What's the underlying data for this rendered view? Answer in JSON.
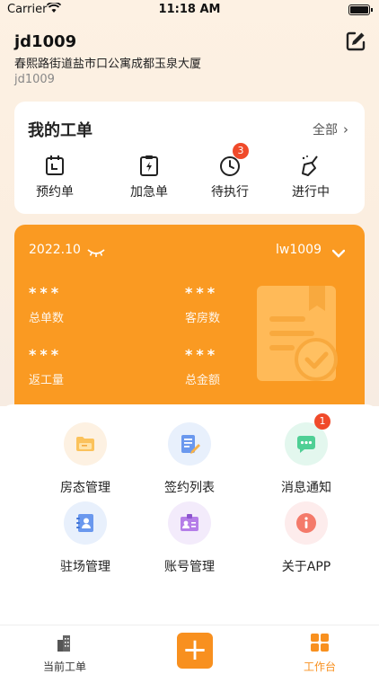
{
  "status_bar": {
    "carrier": "Carrier",
    "time": "11:18 AM"
  },
  "user": {
    "name": "jd1009",
    "address": "春熙路街道盐市口公寓成都玉泉大厦",
    "sub": "jd1009"
  },
  "orders": {
    "title": "我的工单",
    "all_label": "全部",
    "items": [
      {
        "label": "预约单",
        "icon": "calendar-icon"
      },
      {
        "label": "加急单",
        "icon": "clipboard-bolt-icon"
      },
      {
        "label": "待执行",
        "icon": "clock-icon",
        "badge": "3"
      },
      {
        "label": "进行中",
        "icon": "broom-icon"
      }
    ]
  },
  "stats": {
    "date": "2022.10",
    "account": "lw1009",
    "items": [
      {
        "value": "***",
        "label": "总单数"
      },
      {
        "value": "***",
        "label": "客房数"
      },
      {
        "value": "***",
        "label": "返工量"
      },
      {
        "value": "***",
        "label": "总金额"
      }
    ]
  },
  "functions": [
    {
      "label": "房态管理",
      "icon": "folder-icon",
      "bg": "#fdf1e2"
    },
    {
      "label": "签约列表",
      "icon": "document-edit-icon",
      "bg": "#e8f0fc"
    },
    {
      "label": "消息通知",
      "icon": "chat-icon",
      "bg": "#e3f7ee",
      "badge": "1"
    },
    {
      "label": "驻场管理",
      "icon": "contact-book-icon",
      "bg": "#e8f0fc"
    },
    {
      "label": "账号管理",
      "icon": "id-card-icon",
      "bg": "#f3ebfb"
    },
    {
      "label": "关于APP",
      "icon": "info-icon",
      "bg": "#fdecec"
    }
  ],
  "tabs": [
    {
      "label": "当前工单",
      "icon": "buildings-icon"
    },
    {
      "label": "",
      "icon": "plus-icon"
    },
    {
      "label": "工作台",
      "icon": "grid-icon"
    }
  ],
  "colors": {
    "accent": "#f8901f",
    "stats_card": "#fa9a22",
    "badge": "#f04a2a"
  }
}
